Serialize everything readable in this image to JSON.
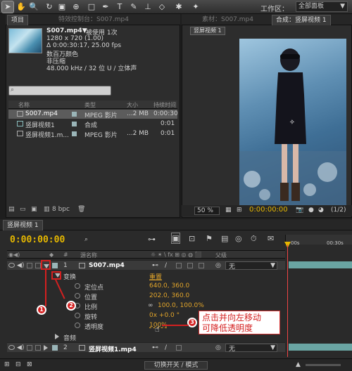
{
  "toolbar": {
    "workspace_label": "工作区：",
    "workspace_value": "全部面板"
  },
  "project_panel": {
    "tabs": [
      "项目",
      "特效控制台：S007.mp4"
    ],
    "item_title": "S007.mp4▼",
    "item_usage": "被使用 1次",
    "info_lines": [
      "1280 x 720 (1.00)",
      "Δ 0:00:30:17, 25.00 fps",
      "数百万颜色",
      "非压缩",
      "48.000 kHz / 32 位 U / 立体声"
    ],
    "columns": [
      "名称",
      "类型",
      "大小",
      "持续时间"
    ],
    "items": [
      {
        "name": "S007.mp4",
        "type": "MPEG 影片",
        "size": "...2 MB",
        "duration": "0:00:30",
        "color": "#9ab5b8"
      },
      {
        "name": "竖屏视频1",
        "type": "合成",
        "size": "",
        "duration": "0:01",
        "color": "#9ab5b8"
      },
      {
        "name": "竖屏视频1.m...",
        "type": "MPEG 影片",
        "size": "...2 MB",
        "duration": "0:01",
        "color": "#9ab5b8"
      }
    ],
    "bpc": "8 bpc"
  },
  "viewer": {
    "tab_material": "素材：S007.mp4",
    "tab_composition": "合成：竖屏视频 1",
    "comp_chip": "竖屏视频 1",
    "zoom": "50 %",
    "resolution": "(1/2)"
  },
  "timeline": {
    "tab": "竖屏视频 1",
    "timecode": "0:00:00:00",
    "col_source": "源名称",
    "col_parent": "父级",
    "ruler_marks": [
      "00s",
      "00:30s"
    ],
    "layers": [
      {
        "num": "1",
        "name": "S007.mp4",
        "parent": "无",
        "color": "#9ab5b8"
      },
      {
        "num": "2",
        "name": "竖屏视频1.mp4",
        "parent": "无",
        "color": "#9ab5b8"
      }
    ],
    "transform_label": "变换",
    "reset_label": "重置",
    "properties": [
      {
        "label": "定位点",
        "value": "640.0, 360.0"
      },
      {
        "label": "位置",
        "value": "202.0, 360.0"
      },
      {
        "label": "比例",
        "value": "100.0, 100.0%"
      },
      {
        "label": "旋转",
        "value": "0x +0.0 °"
      },
      {
        "label": "透明度",
        "value": "100%"
      }
    ],
    "audio_label": "音频",
    "toggle_label": "切换开关 / 模式"
  },
  "annotations": {
    "markers": [
      "1",
      "2",
      "3"
    ],
    "callout_line1": "点击并向左移动",
    "callout_line2": "可降低透明度"
  }
}
